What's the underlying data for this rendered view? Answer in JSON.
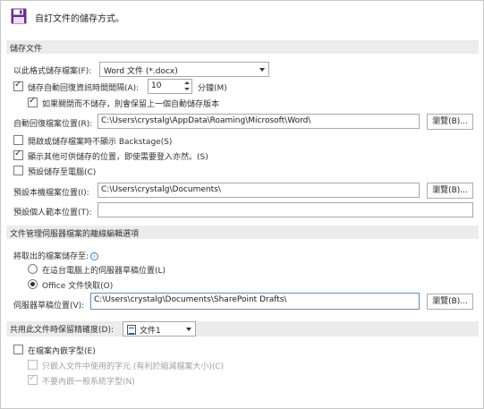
{
  "header": {
    "title": "自訂文件的儲存方式。"
  },
  "save_section": {
    "heading": "儲存文件",
    "format_label": "以此格式儲存檔案(F):",
    "format_value": "Word 文件 (*.docx)",
    "autorecover_label": "儲存自動回復資訊時間間隔(A):",
    "autorecover_value": "10",
    "minutes_label": "分鐘(M)",
    "keep_last_label": "如果關閉而不儲存，則會保留上一個自動儲存版本",
    "autorecover_location_label": "自動回復檔案位置(R):",
    "autorecover_location_value": "C:\\Users\\crystalg\\AppData\\Roaming\\Microsoft\\Word\\",
    "browse_label": "瀏覽(B)...",
    "no_backstage_label": "開啟或儲存檔案時不顯示 Backstage(S)",
    "show_additional_label": "顯示其他可供儲存的位置，即使需要登入亦然。(S)",
    "save_to_computer_label": "預設儲存至電腦(C)",
    "default_local_label": "預設本機檔案位置(I):",
    "default_local_value": "C:\\Users\\crystalg\\Documents\\",
    "default_template_label": "預設個人範本位置(T):",
    "default_template_value": ""
  },
  "server_section": {
    "heading": "文件管理伺服器檔案的離線編輯選項",
    "save_checkout_label": "將取出的檔案儲存至:",
    "radio_server_drafts": "在這台電腦上的伺服器草稿位置(L)",
    "radio_office_cache": "Office 文件快取(O)",
    "drafts_location_label": "伺服器草稿位置(V):",
    "drafts_location_value": "C:\\Users\\crystalg\\Documents\\SharePoint Drafts\\",
    "browse_label": "瀏覽(B)..."
  },
  "fidelity_section": {
    "heading": "共用此文件時保留精確度(D):",
    "document_value": "文件1",
    "embed_fonts_label": "在檔案內嵌字型(E)",
    "embed_used_only_label": "只嵌入文件中使用的字元 (有利於縮減檔案大小)(C)",
    "no_common_fonts_label": "不要內嵌一般系統字型(N)"
  },
  "icons": {
    "header": "save-floppy-icon",
    "document": "word-document-icon",
    "info": "info-icon"
  },
  "colors": {
    "accent": "#6b2c91",
    "section_bg": "#ececec",
    "focus_border": "#5b8fc9"
  }
}
